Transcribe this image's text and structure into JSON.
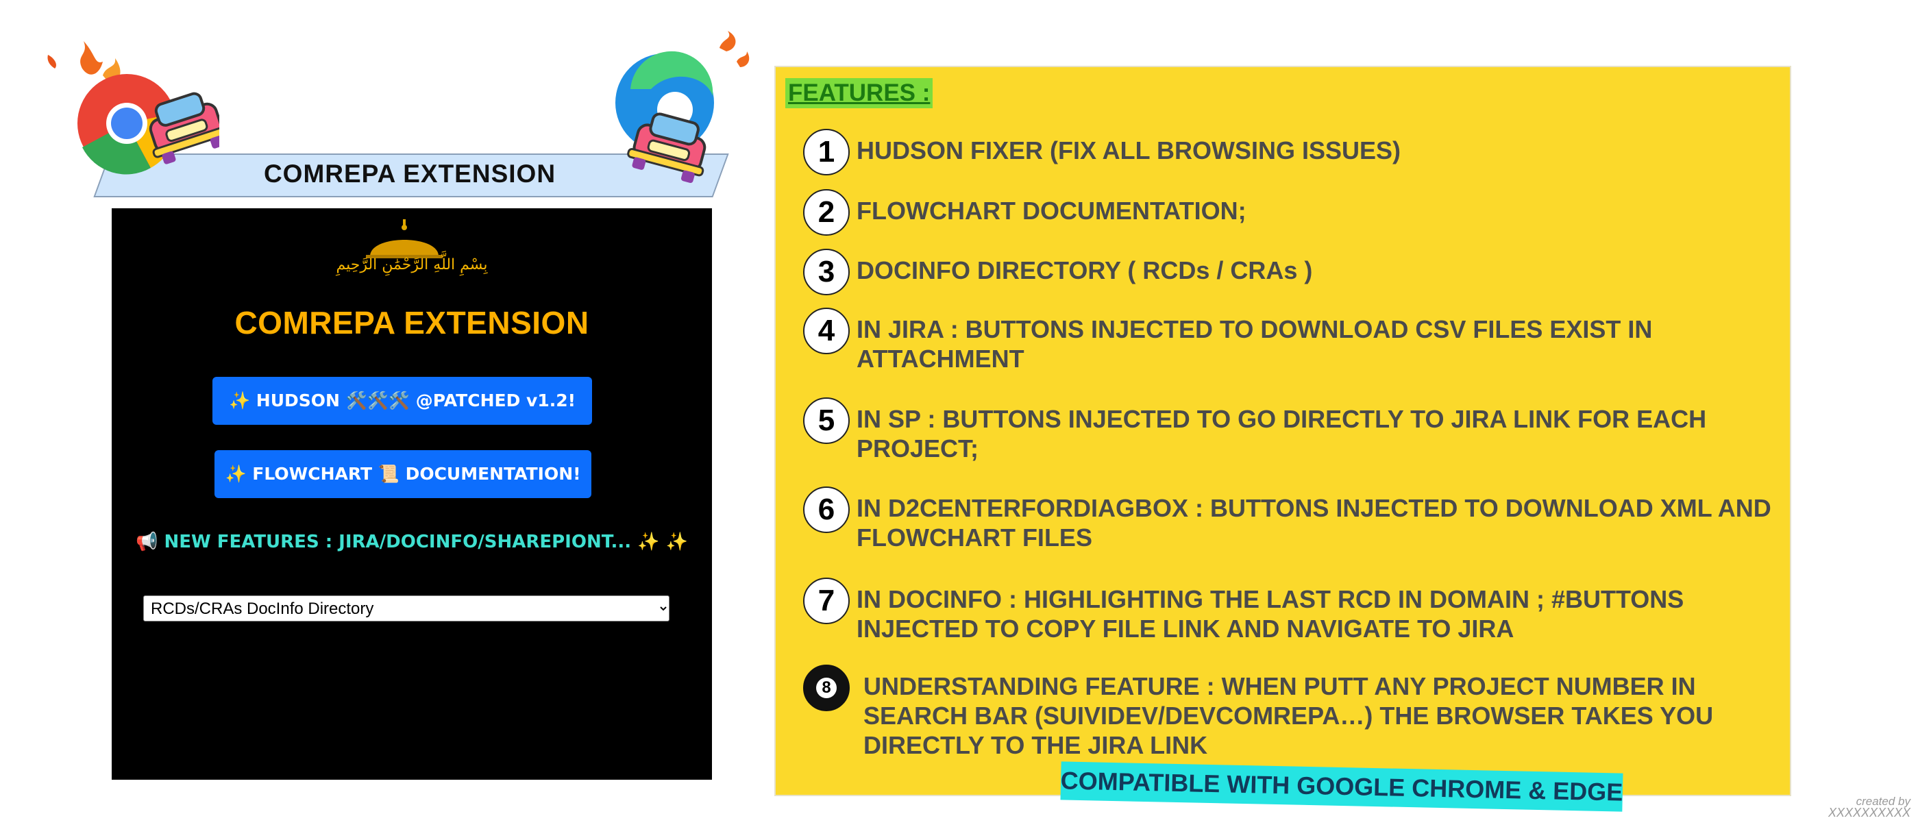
{
  "banner": {
    "title": "COMREPA EXTENSION"
  },
  "logos": {
    "left": "chrome-logo-car",
    "right": "edge-logo-car"
  },
  "popup": {
    "basmala": "بِسْمِ اللَّهِ الرَّحْمَٰنِ الرَّحِيمِ",
    "title": "COMREPA EXTENSION",
    "buttons": [
      {
        "label": "✨ HUDSON 🛠️🛠️🛠️ @PATCHED v1.2!"
      },
      {
        "label": "✨ FLOWCHART 📜 DOCUMENTATION!"
      }
    ],
    "new_features": "📢 NEW FEATURES : JIRA/DOCINFO/SHAREPIONT... ✨ ✨",
    "select": {
      "selected": "RCDs/CRAs DocInfo Directory",
      "options": [
        "RCDs/CRAs DocInfo Directory"
      ]
    }
  },
  "features": {
    "heading": "FEATURES :",
    "items": [
      {
        "num": "1",
        "text": "HUDSON FIXER (FIX ALL BROWSING ISSUES)"
      },
      {
        "num": "2",
        "text": "FLOWCHART DOCUMENTATION;"
      },
      {
        "num": "3",
        "text": "DOCINFO DIRECTORY ( RCDs / CRAs )"
      },
      {
        "num": "4",
        "text": "IN JIRA : BUTTONS INJECTED TO DOWNLOAD CSV FILES EXIST IN ATTACHMENT"
      },
      {
        "num": "5",
        "text": "IN SP : BUTTONS INJECTED TO GO DIRECTLY TO  JIRA LINK FOR EACH PROJECT;"
      },
      {
        "num": "6",
        "text": "IN D2CENTERFORDIAGBOX :  BUTTONS INJECTED TO DOWNLOAD XML AND FLOWCHART FILES"
      },
      {
        "num": "7",
        "text": "IN DOCINFO : HIGHLIGHTING THE LAST RCD IN DOMAIN ; #BUTTONS INJECTED TO COPY FILE LINK AND NAVIGATE TO JIRA"
      },
      {
        "num": "8",
        "text": "UNDERSTANDING FEATURE : WHEN PUTT ANY PROJECT NUMBER IN SEARCH BAR  (SUIVIDEV/DEVCOMREPA…) THE BROWSER TAKES YOU DIRECTLY  TO THE JIRA LINK"
      }
    ],
    "compatible": "COMPATIBLE WITH GOOGLE CHROME & EDGE"
  },
  "credit": {
    "line1": "created by",
    "line2": "XXXXXXXXXX"
  },
  "colors": {
    "panel": "#fbd92b",
    "popup_bg": "#000000",
    "button": "#0d6efd",
    "title": "#ffb000",
    "accent_cyan": "#25e4e2"
  }
}
